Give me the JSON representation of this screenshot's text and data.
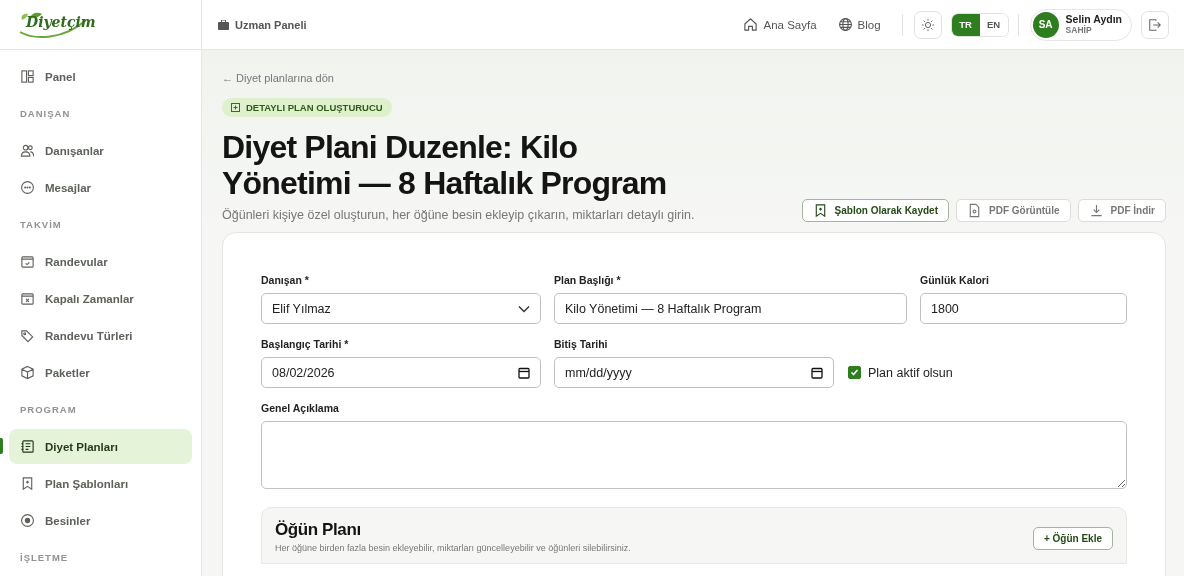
{
  "logo": {
    "text": "Diyetçim"
  },
  "header": {
    "panel_label": "Uzman Paneli",
    "links": [
      {
        "label": "Ana Sayfa"
      },
      {
        "label": "Blog"
      }
    ],
    "languages": [
      {
        "label": "TR",
        "selected": true
      },
      {
        "label": "EN",
        "selected": false
      }
    ],
    "user": {
      "initials": "SA",
      "name": "Selin Aydın",
      "role": "SAHİP"
    }
  },
  "sidebar": {
    "items": [
      {
        "kind": "item",
        "label": "Panel",
        "selected": false
      },
      {
        "kind": "section",
        "label": "DANIŞAN"
      },
      {
        "kind": "item",
        "label": "Danışanlar",
        "selected": false
      },
      {
        "kind": "item",
        "label": "Mesajlar",
        "selected": false
      },
      {
        "kind": "section",
        "label": "TAKVİM"
      },
      {
        "kind": "item",
        "label": "Randevular",
        "selected": false
      },
      {
        "kind": "item",
        "label": "Kapalı Zamanlar",
        "selected": false
      },
      {
        "kind": "item",
        "label": "Randevu Türleri",
        "selected": false
      },
      {
        "kind": "item",
        "label": "Paketler",
        "selected": false
      },
      {
        "kind": "section",
        "label": "PROGRAM"
      },
      {
        "kind": "item",
        "label": "Diyet Planları",
        "selected": true
      },
      {
        "kind": "item",
        "label": "Plan Şablonları",
        "selected": false
      },
      {
        "kind": "item",
        "label": "Besinler",
        "selected": false
      },
      {
        "kind": "section",
        "label": "İŞLETME"
      }
    ]
  },
  "page": {
    "back_link": "← Diyet planlarına dön",
    "badge": "DETAYLI PLAN OLUŞTURUCU",
    "title": "Diyet Plani Duzenle: Kilo Yönetimi — 8 Haftalık Program",
    "subtitle": "Öğünleri kişiye özel oluşturun, her öğüne besin ekleyip çıkarın, miktarları detaylı girin.",
    "actions": [
      {
        "label": "Şablon Olarak Kaydet",
        "primary": true
      },
      {
        "label": "PDF Görüntüle",
        "primary": false
      },
      {
        "label": "PDF İndir",
        "primary": false
      }
    ]
  },
  "form": {
    "client": {
      "label": "Danışan *",
      "value": "Elif Yılmaz"
    },
    "plan_title": {
      "label": "Plan Başlığı *",
      "value": "Kilo Yönetimi — 8 Haftalık Program"
    },
    "calories": {
      "label": "Günlük Kalori",
      "value": "1800"
    },
    "start_date": {
      "label": "Başlangıç Tarihi *",
      "value": "08/02/2026"
    },
    "end_date": {
      "label": "Bitiş Tarihi",
      "placeholder": "mm/dd/yyyy"
    },
    "active": {
      "label": "Plan aktif olsun",
      "checked": true
    },
    "description": {
      "label": "Genel Açıklama"
    }
  },
  "meal_plan": {
    "title": "Öğün Planı",
    "subtitle": "Her öğüne birden fazla besin ekleyebilir, miktarları güncelleyebilir ve öğünleri silebilirsiniz.",
    "add_button": "+ Öğün Ekle"
  }
}
